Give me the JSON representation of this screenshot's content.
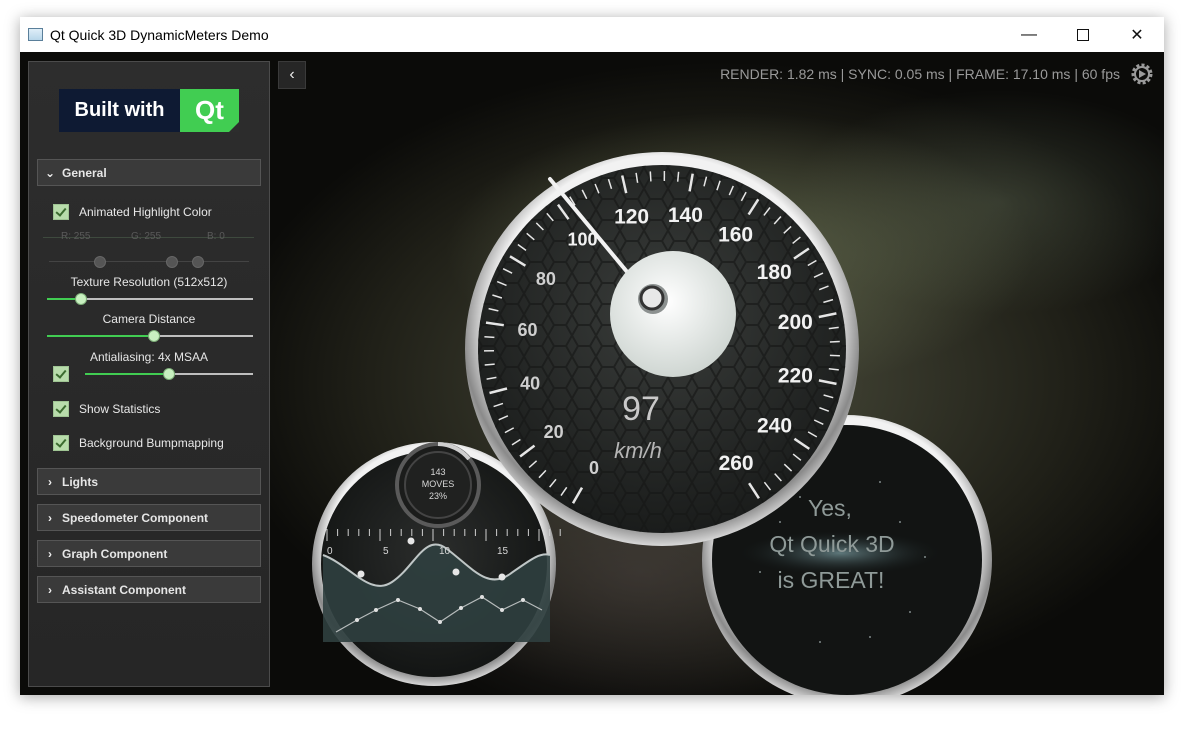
{
  "window": {
    "title": "Qt Quick 3D DynamicMeters Demo"
  },
  "stats": {
    "text": "RENDER: 1.82 ms | SYNC: 0.05 ms | FRAME: 17.10 ms | 60 fps"
  },
  "logo": {
    "text": "Built with",
    "qt": "Qt"
  },
  "panel": {
    "general": {
      "title": "General",
      "animated_highlight": "Animated Highlight Color",
      "r_label": "R: 255",
      "g_label": "G: 255",
      "b_label": "B: 0",
      "texture_resolution": "Texture Resolution (512x512)",
      "texture_resolution_value": 0.15,
      "camera_distance": "Camera Distance",
      "camera_distance_value": 0.5,
      "antialiasing": "Antialiasing: 4x MSAA",
      "antialiasing_value": 0.5,
      "show_statistics": "Show Statistics",
      "background_bumpmapping": "Background Bumpmapping"
    },
    "sections": [
      "Lights",
      "Speedometer Component",
      "Graph Component",
      "Assistant Component"
    ]
  },
  "speedometer": {
    "value": "97",
    "unit": "km/h",
    "ticks": [
      "0",
      "20",
      "40",
      "60",
      "80",
      "100",
      "120",
      "140",
      "160",
      "180",
      "200",
      "220",
      "240",
      "260"
    ]
  },
  "graph_meter": {
    "count": "143",
    "label": "MOVES",
    "percent": "23%",
    "axis": [
      "0",
      "5",
      "10",
      "15"
    ]
  },
  "assistant": {
    "lines": [
      "Yes,",
      "Qt Quick 3D",
      "is GREAT!"
    ]
  },
  "colors": {
    "qt_green": "#41cd52",
    "logo_navy": "#0e1a33",
    "checkbox": "#b8dcab"
  }
}
